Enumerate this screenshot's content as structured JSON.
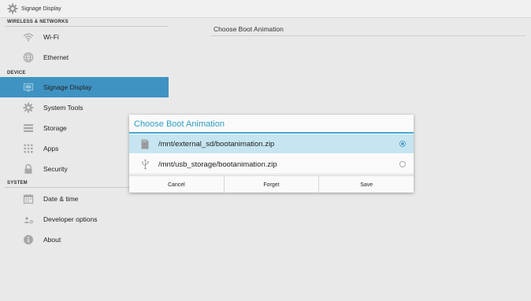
{
  "app": {
    "title": "Signage Display",
    "icon": "gear-icon"
  },
  "sidebar": {
    "sections": [
      {
        "label": "WIRELESS & NETWORKS"
      },
      {
        "label": "DEVICE"
      },
      {
        "label": "SYSTEM"
      }
    ],
    "items": [
      {
        "label": "Wi-Fi",
        "icon": "wifi-icon"
      },
      {
        "label": "Ethernet",
        "icon": "globe-icon"
      },
      {
        "label": "Signage Display",
        "icon": "display-icon",
        "selected": true
      },
      {
        "label": "System Tools",
        "icon": "gear-icon"
      },
      {
        "label": "Storage",
        "icon": "storage-icon"
      },
      {
        "label": "Apps",
        "icon": "apps-grid-icon"
      },
      {
        "label": "Security",
        "icon": "lock-icon"
      },
      {
        "label": "Date & time",
        "icon": "calendar-icon"
      },
      {
        "label": "Developer options",
        "icon": "developer-icon"
      },
      {
        "label": "About",
        "icon": "info-icon"
      }
    ]
  },
  "content": {
    "title": "Choose Boot Animation"
  },
  "dialog": {
    "title": "Choose Boot Animation",
    "options": [
      {
        "label": "/mnt/external_sd/bootanimation.zip",
        "icon": "sd-card-icon",
        "selected": true
      },
      {
        "label": "/mnt/usb_storage/bootanimation.zip",
        "icon": "usb-icon",
        "selected": false
      }
    ],
    "buttons": {
      "cancel": "Cancel",
      "forget": "Forget",
      "save": "Save"
    }
  },
  "colors": {
    "accent": "#2e9dc4",
    "sidebar_selected": "#3f93c2",
    "option_selected": "#c6e5f1",
    "background": "#e9e9e9"
  }
}
